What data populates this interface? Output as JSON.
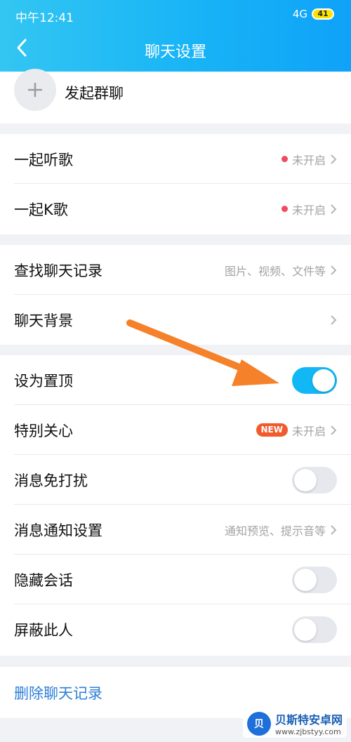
{
  "status_bar": {
    "time": "中午12:41",
    "network": "4G",
    "battery": "41"
  },
  "header": {
    "title": "聊天设置"
  },
  "group_chat": {
    "label": "发起群聊"
  },
  "rows": {
    "listen_together": {
      "label": "一起听歌",
      "value": "未开启"
    },
    "sing_together": {
      "label": "一起K歌",
      "value": "未开启"
    },
    "search_history": {
      "label": "查找聊天记录",
      "value": "图片、视频、文件等"
    },
    "chat_background": {
      "label": "聊天背景"
    },
    "pin_top": {
      "label": "设为置顶",
      "on": true
    },
    "special_care": {
      "label": "特别关心",
      "badge": "NEW",
      "value": "未开启"
    },
    "do_not_disturb": {
      "label": "消息免打扰",
      "on": false
    },
    "notification_settings": {
      "label": "消息通知设置",
      "value": "通知预览、提示音等"
    },
    "hide_chat": {
      "label": "隐藏会话",
      "on": false
    },
    "block_person": {
      "label": "屏蔽此人",
      "on": false
    }
  },
  "delete_history": {
    "label": "删除聊天记录"
  },
  "watermark": {
    "logo": "贝",
    "title": "贝斯特安卓网",
    "url": "www.zjbstyy.com"
  },
  "colors": {
    "accent": "#12b7f5",
    "red_dot": "#f24a5c",
    "link": "#2d7fd8",
    "arrow": "#f5812a"
  },
  "icons": {
    "back": "chevron-left-icon",
    "plus": "plus-icon",
    "chevron": "chevron-right-icon"
  }
}
